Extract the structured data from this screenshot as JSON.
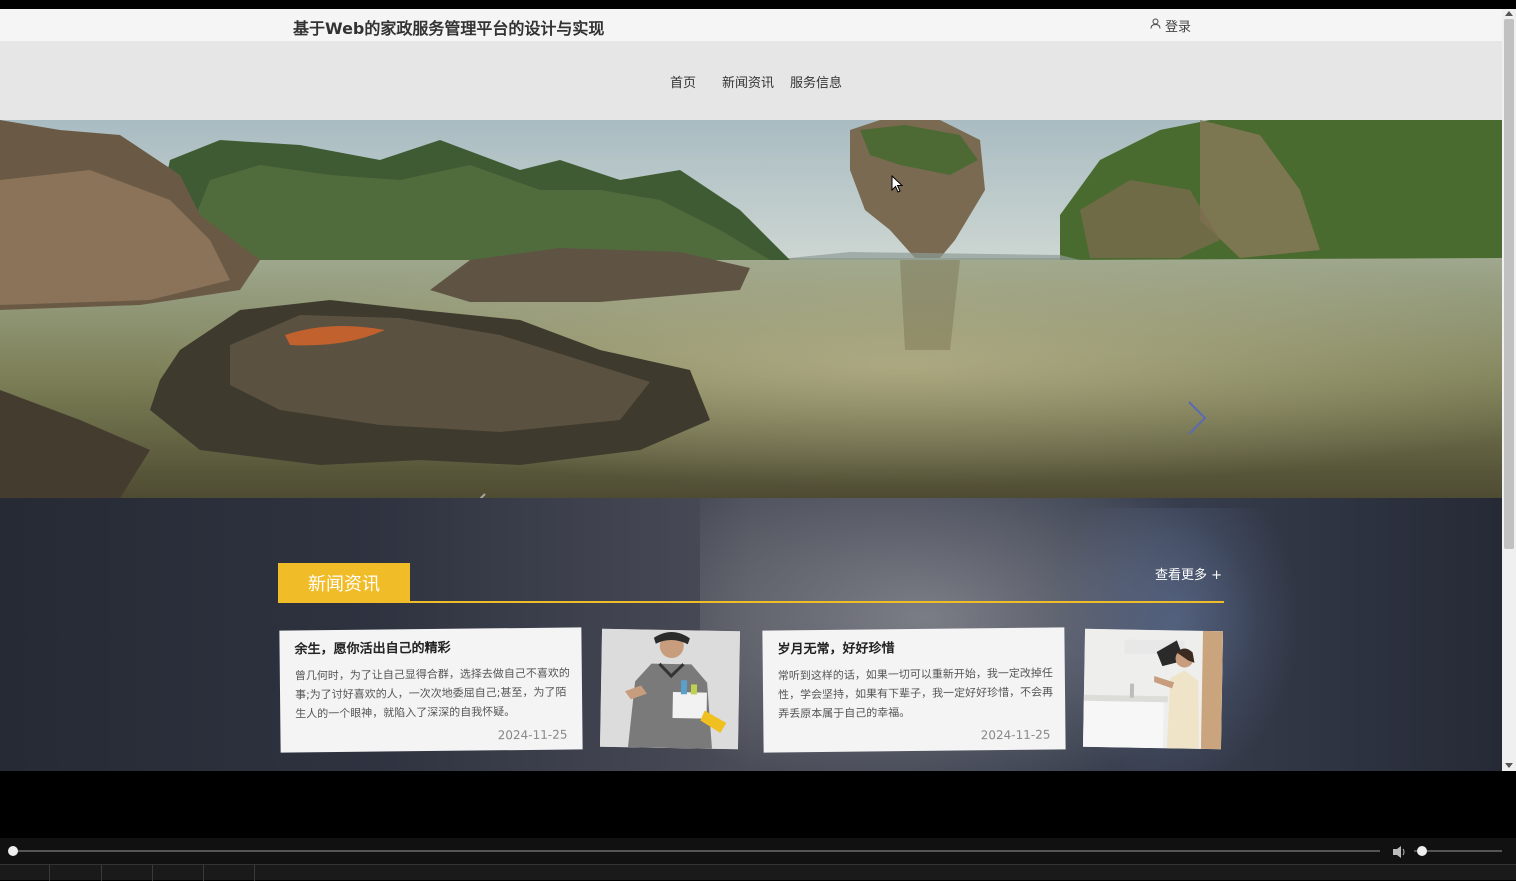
{
  "header": {
    "site_title": "基于Web的家政服务管理平台的设计与实现",
    "login_label": "登录"
  },
  "nav": {
    "items": [
      "首页",
      "新闻资讯",
      "服务信息"
    ]
  },
  "news": {
    "section_title": "新闻资讯",
    "more_label": "查看更多 +",
    "articles": [
      {
        "title": "余生，愿你活出自己的精彩",
        "body": "曾几何时，为了让自己显得合群，选择去做自己不喜欢的事;为了讨好喜欢的人，一次次地委屈自己;甚至，为了陌生人的一个眼神，就陷入了深深的自我怀疑。",
        "date": "2024-11-25"
      },
      {
        "title": "岁月无常，好好珍惜",
        "body": "常听到这样的话，如果一切可以重新开始，我一定改掉任性，学会坚持，如果有下辈子，我一定好好珍惜，不会再弄丢原本属于自己的幸福。",
        "date": "2024-11-25"
      }
    ]
  },
  "colors": {
    "accent": "#f0bc28",
    "nav_bg": "#e6e6e6",
    "topbar_bg": "#f5f5f5"
  }
}
